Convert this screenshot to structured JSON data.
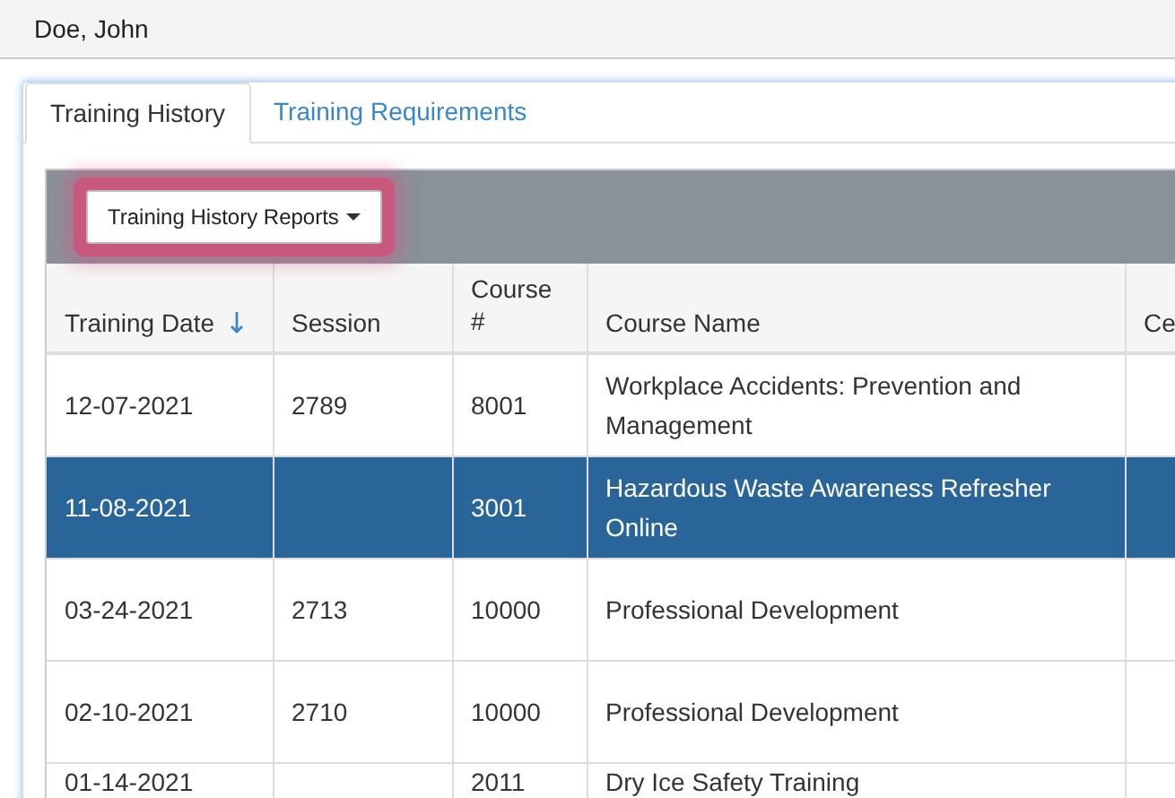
{
  "user_name": "Doe, John",
  "tabs": [
    {
      "label": "Training History",
      "selected": true
    },
    {
      "label": "Training Requirements",
      "selected": false
    }
  ],
  "reports_button": {
    "label": "Training History Reports",
    "highlighted": true
  },
  "table": {
    "columns": [
      {
        "label": "Training Date",
        "sorted": true
      },
      {
        "label": "Session",
        "sorted": false
      },
      {
        "label": "Course #",
        "sorted": false
      },
      {
        "label": "Course Name",
        "sorted": false
      },
      {
        "label": "Ce",
        "sorted": false
      }
    ],
    "rows": [
      {
        "cells": [
          "12-07-2021",
          "2789",
          "8001",
          "Workplace Accidents: Prevention and Management"
        ],
        "selected": false
      },
      {
        "cells": [
          "11-08-2021",
          "",
          "3001",
          "Hazardous Waste Awareness Refresher Online"
        ],
        "selected": true
      },
      {
        "cells": [
          "03-24-2021",
          "2713",
          "10000",
          "Professional Development"
        ],
        "selected": false
      },
      {
        "cells": [
          "02-10-2021",
          "2710",
          "10000",
          "Professional Development"
        ],
        "selected": false
      },
      {
        "cells": [
          "01-14-2021",
          "",
          "2011",
          "Dry Ice Safety Training"
        ],
        "selected": false
      }
    ]
  }
}
